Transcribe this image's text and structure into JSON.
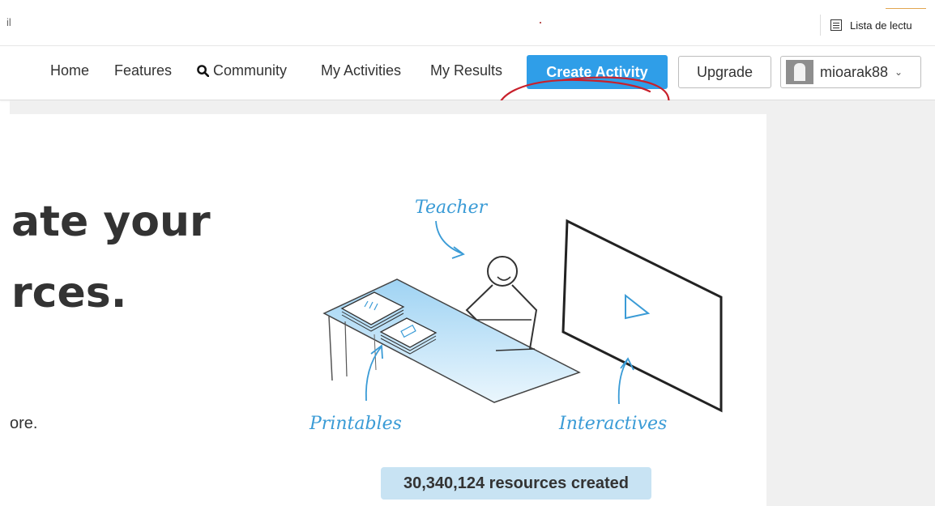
{
  "browser": {
    "url_fragment": "il",
    "reading_list_label": "Lista de lectu"
  },
  "nav": {
    "items": [
      {
        "label": "Home"
      },
      {
        "label": "Features"
      },
      {
        "label": "Community",
        "icon": "search-icon"
      },
      {
        "label": "My Activities"
      },
      {
        "label": "My Results"
      }
    ],
    "create_label": "Create Activity",
    "upgrade_label": "Upgrade",
    "username": "mioarak88",
    "accent_color": "#2f9ee8",
    "annotation_color": "#c8202b"
  },
  "hero": {
    "line1": "ate your",
    "line2": "rces.",
    "sub": "ore.",
    "illustration_labels": {
      "teacher": "Teacher",
      "printables": "Printables",
      "interactives": "Interactives"
    },
    "resources_count": "30,340,124 resources created"
  }
}
